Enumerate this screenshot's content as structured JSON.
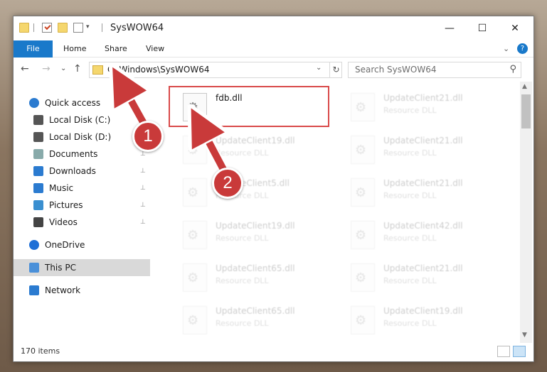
{
  "window": {
    "title": "SysWOW64",
    "min_glyph": "—",
    "max_glyph": "☐",
    "close_glyph": "✕"
  },
  "ribbon": {
    "tabs": [
      "File",
      "Home",
      "Share",
      "View"
    ],
    "collapse_glyph": "⌄",
    "help_glyph": "?"
  },
  "nav": {
    "back": "←",
    "forward": "→",
    "recent": "⌄",
    "up": "↑",
    "address": "C:\\Windows\\SysWOW64",
    "address_drop": "⌄",
    "refresh": "↻",
    "search_placeholder": "Search SysWOW64"
  },
  "sidebar": {
    "items": [
      {
        "label": "Quick access",
        "icon": "star-icon",
        "pinned": false
      },
      {
        "label": "Local Disk (C:)",
        "icon": "drive-icon",
        "pinned": true
      },
      {
        "label": "Local Disk (D:)",
        "icon": "drive-icon",
        "pinned": true
      },
      {
        "label": "Documents",
        "icon": "documents-icon",
        "pinned": true
      },
      {
        "label": "Downloads",
        "icon": "download-icon",
        "pinned": true
      },
      {
        "label": "Music",
        "icon": "music-icon",
        "pinned": true
      },
      {
        "label": "Pictures",
        "icon": "pictures-icon",
        "pinned": true
      },
      {
        "label": "Videos",
        "icon": "videos-icon",
        "pinned": true
      },
      {
        "label": "OneDrive",
        "icon": "cloud-icon",
        "pinned": false
      },
      {
        "label": "This PC",
        "icon": "computer-icon",
        "pinned": false,
        "selected": true
      },
      {
        "label": "Network",
        "icon": "network-icon",
        "pinned": false
      }
    ],
    "pin_glyph": "📌"
  },
  "files": {
    "left": [
      {
        "name": "fdb.dll",
        "type": ""
      },
      {
        "name": "UpdateClient19.dll",
        "type": "Resource DLL"
      },
      {
        "name": "UpdateClient5.dll",
        "type": "Resource DLL"
      },
      {
        "name": "UpdateClient19.dll",
        "type": "Resource DLL"
      },
      {
        "name": "UpdateClient65.dll",
        "type": "Resource DLL"
      },
      {
        "name": "UpdateClient65.dll",
        "type": "Resource DLL"
      }
    ],
    "right": [
      {
        "name": "UpdateClient21.dll",
        "type": "Resource DLL"
      },
      {
        "name": "UpdateClient21.dll",
        "type": "Resource DLL"
      },
      {
        "name": "UpdateClient21.dll",
        "type": "Resource DLL"
      },
      {
        "name": "UpdateClient42.dll",
        "type": "Resource DLL"
      },
      {
        "name": "UpdateClient21.dll",
        "type": "Resource DLL"
      },
      {
        "name": "UpdateClient19.dll",
        "type": "Resource DLL"
      }
    ]
  },
  "status": {
    "count": "170 items"
  },
  "annotations": {
    "step1": "1",
    "step2": "2",
    "color": "#c93a3a"
  }
}
